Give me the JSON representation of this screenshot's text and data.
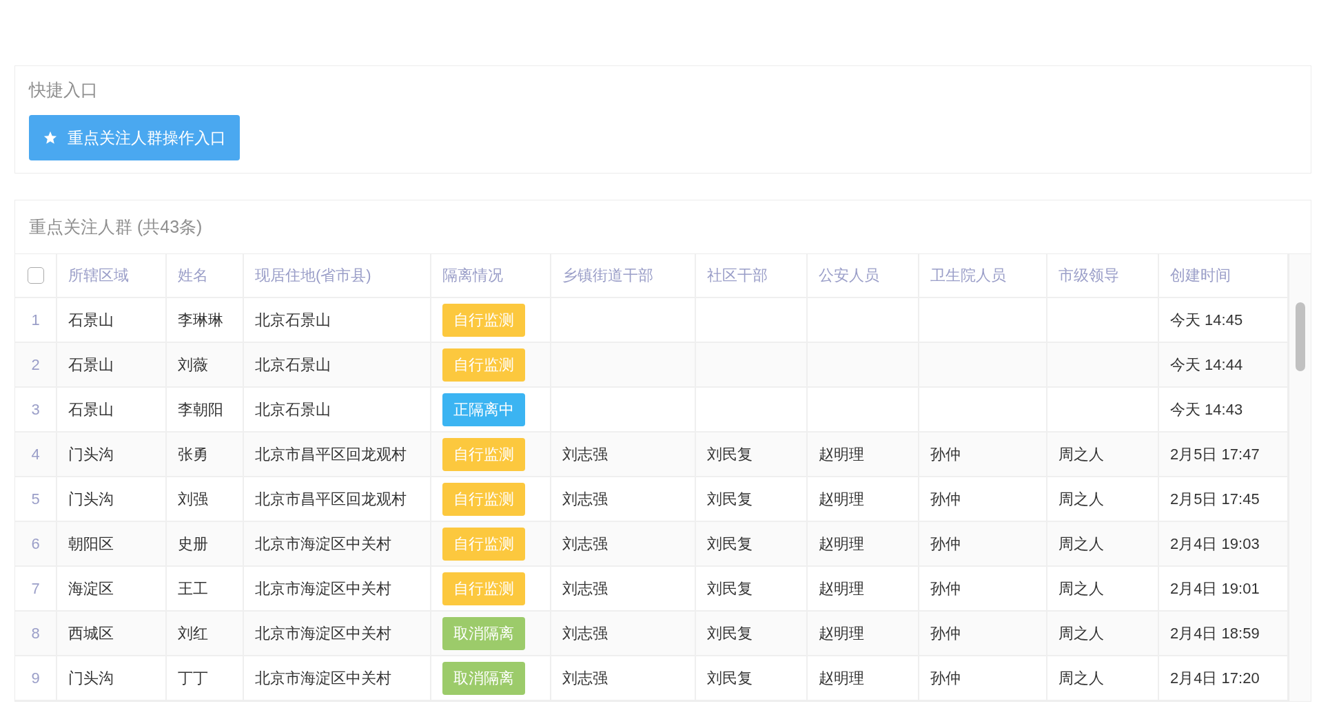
{
  "quick_entry": {
    "title": "快捷入口",
    "button": "重点关注人群操作入口"
  },
  "list": {
    "title": "重点关注人群 (共43条)",
    "select_all": {
      "checked": false
    },
    "columns": [
      "所辖区域",
      "姓名",
      "现居住地(省市县)",
      "隔离情况",
      "乡镇街道干部",
      "社区干部",
      "公安人员",
      "卫生院人员",
      "市级领导",
      "创建时间"
    ],
    "rows": [
      {
        "index": "1",
        "area": "石景山",
        "name": "李琳琳",
        "address": "北京石景山",
        "status": {
          "label": "自行监测",
          "kind": "self_monitor"
        },
        "town_cadre": "",
        "community_cadre": "",
        "police": "",
        "health": "",
        "leader": "",
        "created": "今天 14:45"
      },
      {
        "index": "2",
        "area": "石景山",
        "name": "刘薇",
        "address": "北京石景山",
        "status": {
          "label": "自行监测",
          "kind": "self_monitor"
        },
        "town_cadre": "",
        "community_cadre": "",
        "police": "",
        "health": "",
        "leader": "",
        "created": "今天 14:44"
      },
      {
        "index": "3",
        "area": "石景山",
        "name": "李朝阳",
        "address": "北京石景山",
        "status": {
          "label": "正隔离中",
          "kind": "isolating"
        },
        "town_cadre": "",
        "community_cadre": "",
        "police": "",
        "health": "",
        "leader": "",
        "created": "今天 14:43"
      },
      {
        "index": "4",
        "area": "门头沟",
        "name": "张勇",
        "address": "北京市昌平区回龙观村",
        "status": {
          "label": "自行监测",
          "kind": "self_monitor"
        },
        "town_cadre": "刘志强",
        "community_cadre": "刘民复",
        "police": "赵明理",
        "health": "孙仲",
        "leader": "周之人",
        "created": "2月5日 17:47"
      },
      {
        "index": "5",
        "area": "门头沟",
        "name": "刘强",
        "address": "北京市昌平区回龙观村",
        "status": {
          "label": "自行监测",
          "kind": "self_monitor"
        },
        "town_cadre": "刘志强",
        "community_cadre": "刘民复",
        "police": "赵明理",
        "health": "孙仲",
        "leader": "周之人",
        "created": "2月5日 17:45"
      },
      {
        "index": "6",
        "area": "朝阳区",
        "name": "史册",
        "address": "北京市海淀区中关村",
        "status": {
          "label": "自行监测",
          "kind": "self_monitor"
        },
        "town_cadre": "刘志强",
        "community_cadre": "刘民复",
        "police": "赵明理",
        "health": "孙仲",
        "leader": "周之人",
        "created": "2月4日 19:03"
      },
      {
        "index": "7",
        "area": "海淀区",
        "name": "王工",
        "address": "北京市海淀区中关村",
        "status": {
          "label": "自行监测",
          "kind": "self_monitor"
        },
        "town_cadre": "刘志强",
        "community_cadre": "刘民复",
        "police": "赵明理",
        "health": "孙仲",
        "leader": "周之人",
        "created": "2月4日 19:01"
      },
      {
        "index": "8",
        "area": "西城区",
        "name": "刘红",
        "address": "北京市海淀区中关村",
        "status": {
          "label": "取消隔离",
          "kind": "cancelled"
        },
        "town_cadre": "刘志强",
        "community_cadre": "刘民复",
        "police": "赵明理",
        "health": "孙仲",
        "leader": "周之人",
        "created": "2月4日 18:59"
      },
      {
        "index": "9",
        "area": "门头沟",
        "name": "丁丁",
        "address": "北京市海淀区中关村",
        "status": {
          "label": "取消隔离",
          "kind": "cancelled"
        },
        "town_cadre": "刘志强",
        "community_cadre": "刘民复",
        "police": "赵明理",
        "health": "孙仲",
        "leader": "周之人",
        "created": "2月4日 17:20"
      }
    ]
  }
}
